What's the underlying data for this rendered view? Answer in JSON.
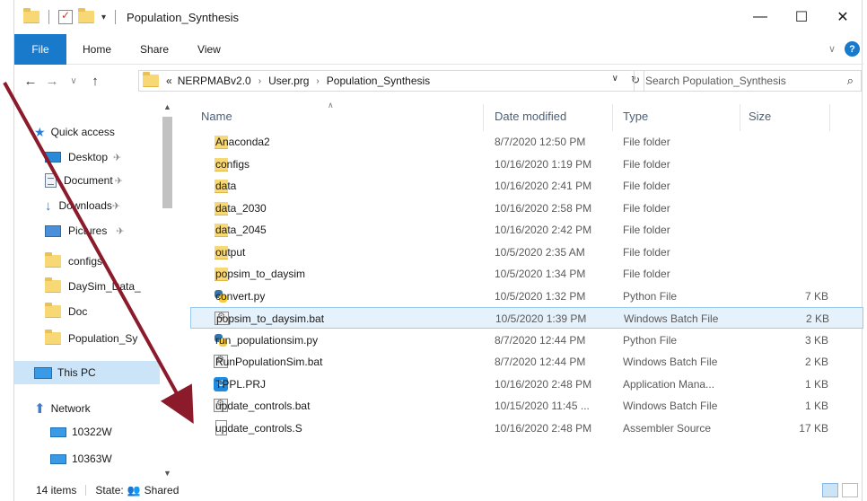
{
  "window": {
    "title": "Population_Synthesis",
    "controls": {
      "minimize": "—",
      "maximize": "☐",
      "close": "✕"
    }
  },
  "ribbon": {
    "tabs": [
      "File",
      "Home",
      "Share",
      "View"
    ],
    "help": "?"
  },
  "address": {
    "crumbs": [
      "«",
      "NERPMABv2.0",
      "User.prg",
      "Population_Synthesis"
    ],
    "search_placeholder": "Search Population_Synthesis"
  },
  "nav": {
    "items": [
      {
        "label": "Quick access",
        "icon": "star-icon"
      },
      {
        "label": "Desktop",
        "icon": "desktop-icon",
        "pinned": true
      },
      {
        "label": "Document",
        "icon": "documents-icon",
        "pinned": true
      },
      {
        "label": "Downloads",
        "icon": "download-icon",
        "pinned": true
      },
      {
        "label": "Pictures",
        "icon": "pictures-icon",
        "pinned": true
      },
      {
        "label": "configs",
        "icon": "folder-icon"
      },
      {
        "label": "DaySim_Data_",
        "icon": "folder-icon"
      },
      {
        "label": "Doc",
        "icon": "folder-icon"
      },
      {
        "label": "Population_Sy",
        "icon": "folder-icon"
      },
      {
        "label": "This PC",
        "icon": "pc-icon"
      },
      {
        "label": "Network",
        "icon": "network-icon"
      },
      {
        "label": "10322W",
        "icon": "computer-icon"
      },
      {
        "label": "10363W",
        "icon": "computer-icon"
      }
    ]
  },
  "columns": {
    "name": "Name",
    "date": "Date modified",
    "type": "Type",
    "size": "Size"
  },
  "files": [
    {
      "name": "Anaconda2",
      "date": "8/7/2020 12:50 PM",
      "type": "File folder",
      "size": "",
      "icon": "folder"
    },
    {
      "name": "configs",
      "date": "10/16/2020 1:19 PM",
      "type": "File folder",
      "size": "",
      "icon": "folder"
    },
    {
      "name": "data",
      "date": "10/16/2020 2:41 PM",
      "type": "File folder",
      "size": "",
      "icon": "folder"
    },
    {
      "name": "data_2030",
      "date": "10/16/2020 2:58 PM",
      "type": "File folder",
      "size": "",
      "icon": "folder"
    },
    {
      "name": "data_2045",
      "date": "10/16/2020 2:42 PM",
      "type": "File folder",
      "size": "",
      "icon": "folder"
    },
    {
      "name": "output",
      "date": "10/5/2020 2:35 AM",
      "type": "File folder",
      "size": "",
      "icon": "folder"
    },
    {
      "name": "popsim_to_daysim",
      "date": "10/5/2020 1:34 PM",
      "type": "File folder",
      "size": "",
      "icon": "folder"
    },
    {
      "name": "convert.py",
      "date": "10/5/2020 1:32 PM",
      "type": "Python File",
      "size": "7 KB",
      "icon": "py"
    },
    {
      "name": "popsim_to_daysim.bat",
      "date": "10/5/2020 1:39 PM",
      "type": "Windows Batch File",
      "size": "2 KB",
      "icon": "bat"
    },
    {
      "name": "run_populationsim.py",
      "date": "8/7/2020 12:44 PM",
      "type": "Python File",
      "size": "3 KB",
      "icon": "py"
    },
    {
      "name": "RunPopulationSim.bat",
      "date": "8/7/2020 12:44 PM",
      "type": "Windows Batch File",
      "size": "2 KB",
      "icon": "bat"
    },
    {
      "name": "TPPL.PRJ",
      "date": "10/16/2020 2:48 PM",
      "type": "Application Mana...",
      "size": "1 KB",
      "icon": "app"
    },
    {
      "name": "update_controls.bat",
      "date": "10/15/2020 11:45 ...",
      "type": "Windows Batch File",
      "size": "1 KB",
      "icon": "bat"
    },
    {
      "name": "update_controls.S",
      "date": "10/16/2020 2:48 PM",
      "type": "Assembler Source",
      "size": "17 KB",
      "icon": "file"
    }
  ],
  "selected_index": 8,
  "status": {
    "count": "14 items",
    "state_label": "State:",
    "state_value": "Shared"
  },
  "colors": {
    "accent": "#1979ca",
    "arrow": "#8b1a2b",
    "folder": "#f8d775"
  }
}
